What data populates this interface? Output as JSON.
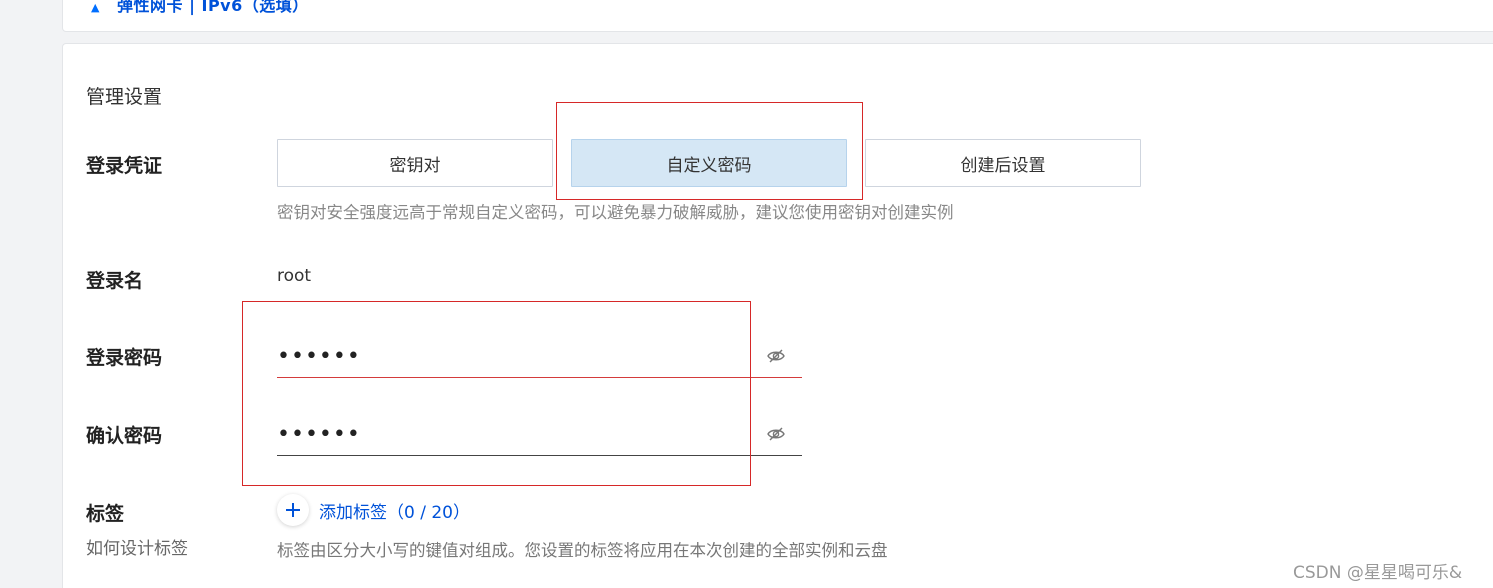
{
  "top_section": {
    "title": "弹性网卡 | IPv6（选填）"
  },
  "section": {
    "title": "管理设置"
  },
  "login_credential": {
    "label": "登录凭证",
    "options": [
      {
        "label": "密钥对",
        "selected": false
      },
      {
        "label": "自定义密码",
        "selected": true
      },
      {
        "label": "创建后设置",
        "selected": false
      }
    ],
    "hint": "密钥对安全强度远高于常规自定义密码，可以避免暴力破解威胁，建议您使用密钥对创建实例"
  },
  "login_name": {
    "label": "登录名",
    "value": "root"
  },
  "login_password": {
    "label": "登录密码",
    "value": "••••••"
  },
  "confirm_password": {
    "label": "确认密码",
    "value": "••••••"
  },
  "tags": {
    "label": "标签",
    "sub_link": "如何设计标签",
    "add_label": "添加标签（0 / 20）",
    "hint": "标签由区分大小写的键值对组成。您设置的标签将应用在本次创建的全部实例和云盘"
  },
  "watermark": "CSDN @星星喝可乐&",
  "colors": {
    "accent": "#0052d9",
    "selected_bg": "#d5e7f5",
    "annotation_red": "#d62828",
    "error_underline": "#d43b3b"
  },
  "icons": {
    "collapse": "caret-up-icon",
    "password_toggle": "eye-off-icon",
    "add_tag": "plus-icon"
  }
}
